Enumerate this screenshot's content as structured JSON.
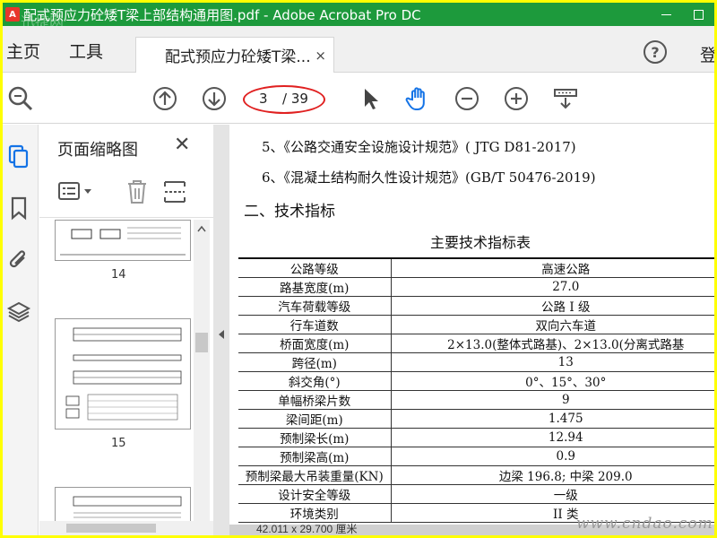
{
  "window": {
    "title": "配式预应力砼矮T梁上部结构通用图.pdf - Adobe Acrobat Pro DC",
    "logo_glyph": "A",
    "overlay_text": "迅捷网"
  },
  "menubar": {
    "home_label": "主页",
    "tools_label": "工具",
    "tab_title": "配式预应力砼矮T梁...",
    "tab_close": "×",
    "help_label": "?",
    "login_label": "登"
  },
  "toolbar": {
    "current_page": "3",
    "total_pages": "/ 39"
  },
  "panel": {
    "title": "页面缩略图",
    "close_glyph": "✕",
    "thumbnails": [
      {
        "label": "14"
      },
      {
        "label": "15"
      },
      {
        "label": ""
      }
    ]
  },
  "document": {
    "lines": [
      "5、《公路交通安全设施设计规范》( JTG D81-2017)",
      "6、《混凝土结构耐久性设计规范》(GB/T 50476-2019)"
    ],
    "section_heading": "二、技术指标",
    "table_caption": "主要技术指标表",
    "table_rows": [
      {
        "key": "公路等级",
        "value": "高速公路"
      },
      {
        "key": "路基宽度(m)",
        "value": "27.0"
      },
      {
        "key": "汽车荷载等级",
        "value": "公路 I 级"
      },
      {
        "key": "行车道数",
        "value": "双向六车道"
      },
      {
        "key": "桥面宽度(m)",
        "value": "2×13.0(整体式路基)、2×13.0(分离式路基"
      },
      {
        "key": "跨径(m)",
        "value": "13"
      },
      {
        "key": "斜交角(°)",
        "value": "0°、15°、30°"
      },
      {
        "key": "单幅桥梁片数",
        "value": "9"
      },
      {
        "key": "梁间距(m)",
        "value": "1.475"
      },
      {
        "key": "预制梁长(m)",
        "value": "12.94"
      },
      {
        "key": "预制梁高(m)",
        "value": "0.9"
      },
      {
        "key": "预制梁最大吊装重量(KN)",
        "value": "边梁 196.8; 中梁 209.0"
      },
      {
        "key": "设计安全等级",
        "value": "一级"
      },
      {
        "key": "环境类别",
        "value": "II 类"
      }
    ],
    "status_text": "42.011 x 29.700 厘米"
  },
  "watermark": "www.cndao.com",
  "colors": {
    "titlebar": "#1d9a3c",
    "frame": "#ffff00",
    "accent_blue": "#1473e6",
    "highlight_red": "#e02020"
  },
  "icons": {
    "zoom": "magnifier-icon",
    "prev_page": "arrow-up-circle-icon",
    "next_page": "arrow-down-circle-icon",
    "select": "cursor-arrow-icon",
    "hand": "hand-icon",
    "zoom_out": "minus-circle-icon",
    "zoom_in": "plus-circle-icon",
    "marquee": "marquee-zoom-icon"
  }
}
